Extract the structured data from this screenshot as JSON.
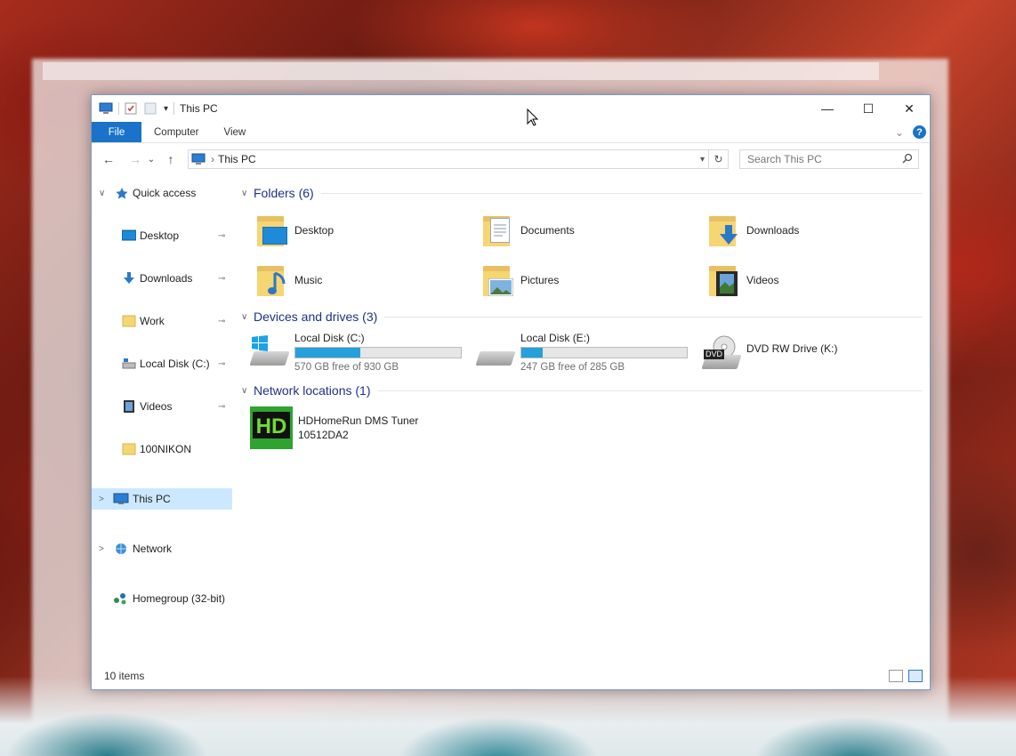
{
  "window": {
    "title": "This PC",
    "controls": {
      "minimize": "—",
      "maximize": "☐",
      "close": "✕"
    }
  },
  "ribbon": {
    "tabs": [
      {
        "label": "File"
      },
      {
        "label": "Computer"
      },
      {
        "label": "View"
      }
    ],
    "help": "?",
    "expand": "⌄"
  },
  "navigation": {
    "back": "←",
    "forward": "→",
    "recent": "⌄",
    "up": "↑",
    "address": "This PC",
    "address_sep": "›",
    "refresh": "↻",
    "search_placeholder": "Search This PC",
    "search_icon": "search-icon"
  },
  "sidebar": {
    "items": [
      {
        "label": "Quick access",
        "icon": "star-icon",
        "chevron": "∨"
      },
      {
        "label": "Desktop",
        "icon": "desktop-icon",
        "pinned": "📌"
      },
      {
        "label": "Downloads",
        "icon": "downloads-icon",
        "pinned": "📌"
      },
      {
        "label": "Work",
        "icon": "folder-icon",
        "pinned": "📌"
      },
      {
        "label": "Local Disk (C:)",
        "icon": "drive-icon",
        "pinned": "📌"
      },
      {
        "label": "Videos",
        "icon": "videos-icon",
        "pinned": "📌"
      },
      {
        "label": "100NIKON",
        "icon": "folder-icon"
      },
      {
        "label": "This PC",
        "icon": "computer-icon",
        "chevron": ">",
        "selected": true
      },
      {
        "label": "Network",
        "icon": "network-icon",
        "chevron": ">"
      },
      {
        "label": "Homegroup (32-bit)",
        "icon": "homegroup-icon"
      }
    ]
  },
  "groups": {
    "folders": {
      "title": "Folders (6)",
      "items": [
        {
          "label": "Desktop",
          "icon": "desktop-folder-icon"
        },
        {
          "label": "Documents",
          "icon": "documents-folder-icon"
        },
        {
          "label": "Downloads",
          "icon": "downloads-folder-icon"
        },
        {
          "label": "Music",
          "icon": "music-folder-icon"
        },
        {
          "label": "Pictures",
          "icon": "pictures-folder-icon"
        },
        {
          "label": "Videos",
          "icon": "videos-folder-icon"
        }
      ]
    },
    "drives": {
      "title": "Devices and drives (3)",
      "items": [
        {
          "label": "Local Disk (C:)",
          "free": "570 GB free of 930 GB",
          "used_fraction": 0.39,
          "icon": "windows-drive-icon"
        },
        {
          "label": "Local Disk (E:)",
          "free": "247 GB free of 285 GB",
          "used_fraction": 0.13,
          "icon": "drive-icon"
        },
        {
          "label": "DVD RW Drive (K:)",
          "icon": "dvd-drive-icon",
          "badge": "DVD"
        }
      ]
    },
    "network": {
      "title": "Network locations (1)",
      "items": [
        {
          "label": "HDHomeRun DMS Tuner",
          "sublabel": "10512DA2",
          "icon": "hdhomerun-icon",
          "badge": "HD"
        }
      ]
    }
  },
  "status": {
    "item_count": "10 items"
  },
  "colors": {
    "accent": "#1a73c8",
    "selection": "#cce8ff",
    "group_header": "#1e3287",
    "drive_bar": "#26a0da"
  }
}
